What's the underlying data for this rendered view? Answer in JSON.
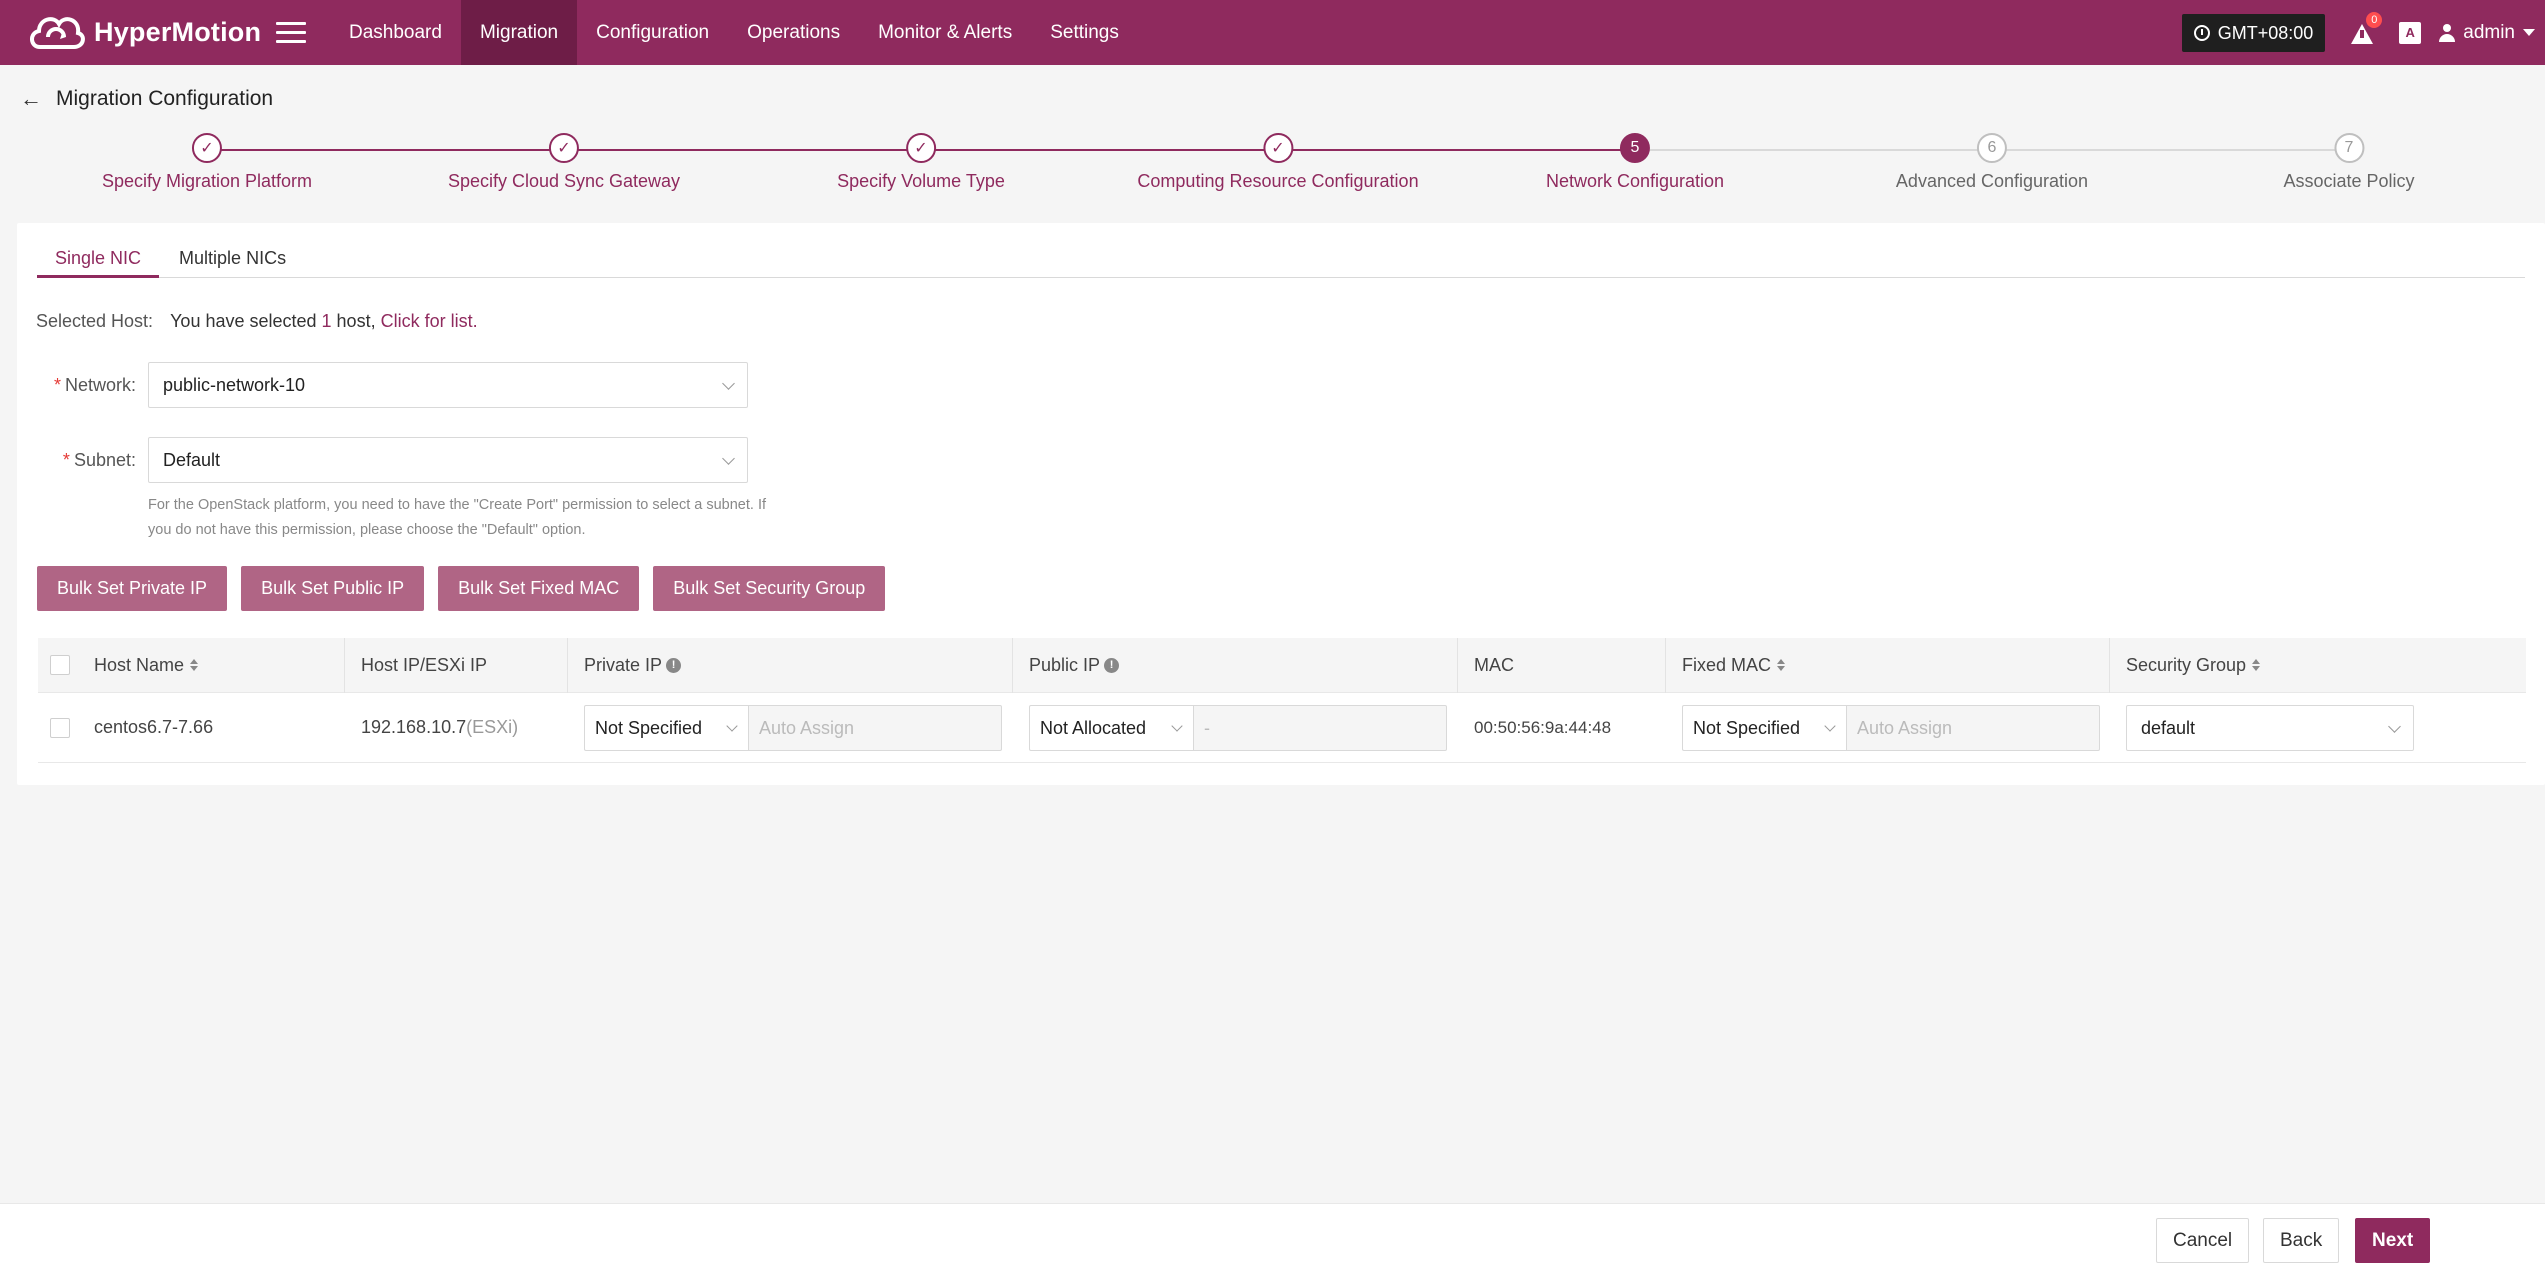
{
  "app": {
    "name": "HyperMotion"
  },
  "nav": {
    "items": [
      {
        "label": "Dashboard",
        "active": false
      },
      {
        "label": "Migration",
        "active": true
      },
      {
        "label": "Configuration",
        "active": false
      },
      {
        "label": "Operations",
        "active": false
      },
      {
        "label": "Monitor & Alerts",
        "active": false
      },
      {
        "label": "Settings",
        "active": false
      }
    ],
    "timezone": "GMT+08:00",
    "alert_count": "0",
    "lang_icon": "A",
    "user": "admin"
  },
  "page": {
    "title": "Migration Configuration"
  },
  "steps": [
    {
      "label": "Specify Migration Platform",
      "status": "done",
      "mark": "✓"
    },
    {
      "label": "Specify Cloud Sync Gateway",
      "status": "done",
      "mark": "✓"
    },
    {
      "label": "Specify Volume Type",
      "status": "done",
      "mark": "✓"
    },
    {
      "label": "Computing Resource Configuration",
      "status": "done",
      "mark": "✓"
    },
    {
      "label": "Network Configuration",
      "status": "current",
      "mark": "5"
    },
    {
      "label": "Advanced Configuration",
      "status": "todo",
      "mark": "6"
    },
    {
      "label": "Associate Policy",
      "status": "todo",
      "mark": "7"
    }
  ],
  "tabs": [
    {
      "label": "Single NIC",
      "active": true
    },
    {
      "label": "Multiple NICs",
      "active": false
    }
  ],
  "selected_host": {
    "label": "Selected Host:",
    "prefix": "You have selected ",
    "count": "1",
    "middle": " host, ",
    "link": "Click for list",
    "suffix": "."
  },
  "form": {
    "network": {
      "required": "*",
      "label": "Network:",
      "value": "public-network-10"
    },
    "subnet": {
      "required": "*",
      "label": "Subnet:",
      "value": "Default"
    },
    "hint": "For the OpenStack platform, you need to have the \"Create Port\" permission to select a subnet. If you do not have this permission, please choose the \"Default\" option."
  },
  "bulk_buttons": [
    "Bulk Set Private IP",
    "Bulk Set Public IP",
    "Bulk Set Fixed MAC",
    "Bulk Set Security Group"
  ],
  "table": {
    "headers": {
      "host_name": "Host Name",
      "host_ip": "Host IP/ESXi IP",
      "private_ip": "Private IP",
      "public_ip": "Public IP",
      "mac": "MAC",
      "fixed_mac": "Fixed MAC",
      "security_group": "Security Group"
    },
    "rows": [
      {
        "host_name": "centos6.7-7.66",
        "host_ip": "192.168.10.7",
        "host_ip_suffix": "(ESXi)",
        "private_ip_mode": "Not Specified",
        "private_ip_placeholder": "Auto Assign",
        "public_ip_mode": "Not Allocated",
        "public_ip_placeholder": "-",
        "mac": "00:50:56:9a:44:48",
        "fixed_mac_mode": "Not Specified",
        "fixed_mac_placeholder": "Auto Assign",
        "security_group": "default"
      }
    ]
  },
  "footer": {
    "cancel": "Cancel",
    "back": "Back",
    "next": "Next"
  },
  "colors": {
    "brand": "#8f2a5e",
    "button": "#b06585",
    "nav_active": "#6e1d47"
  }
}
